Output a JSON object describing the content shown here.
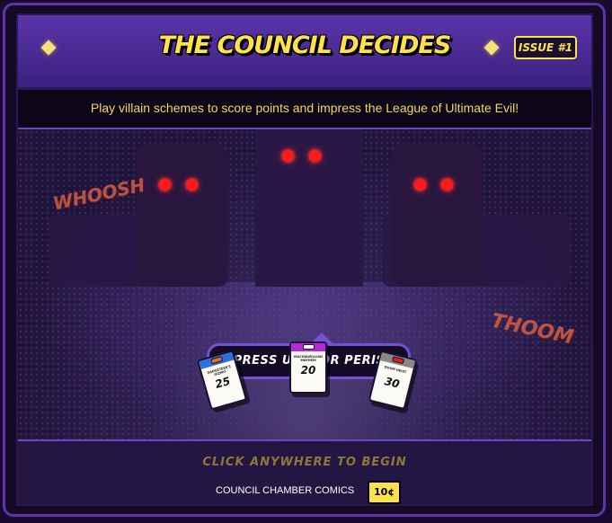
{
  "header": {
    "title": "THE COUNCIL DECIDES",
    "issue_label": "ISSUE #1"
  },
  "subtitle": "Play villain schemes to score points and impress the League of Ultimate Evil!",
  "stage": {
    "speech": "IMPRESS US... OR PERISH!",
    "sfx_left": "WHOOSH",
    "sfx_right": "THOOM",
    "cards": [
      {
        "name": "GADGETEER'S GIZMO",
        "points": "25",
        "accent": "#e86d16",
        "bar": "#2d6fe0"
      },
      {
        "name": "MACHIAVELLIAN MAYHEM",
        "points": "20",
        "accent": "#b32ad6",
        "bar": "#b32ad6"
      },
      {
        "name": "DOOM HEIST",
        "points": "30",
        "accent": "#d42424",
        "bar": "#888888"
      }
    ]
  },
  "footer": {
    "begin": "CLICK ANYWHERE TO BEGIN",
    "publisher": "COUNCIL CHAMBER COMICS",
    "price": "10¢"
  },
  "colors": {
    "accent_yellow": "#ffe14a",
    "header_purple": "#5a34a8",
    "eye_red": "#ff1a1a",
    "bubble_border": "#7750d4"
  }
}
